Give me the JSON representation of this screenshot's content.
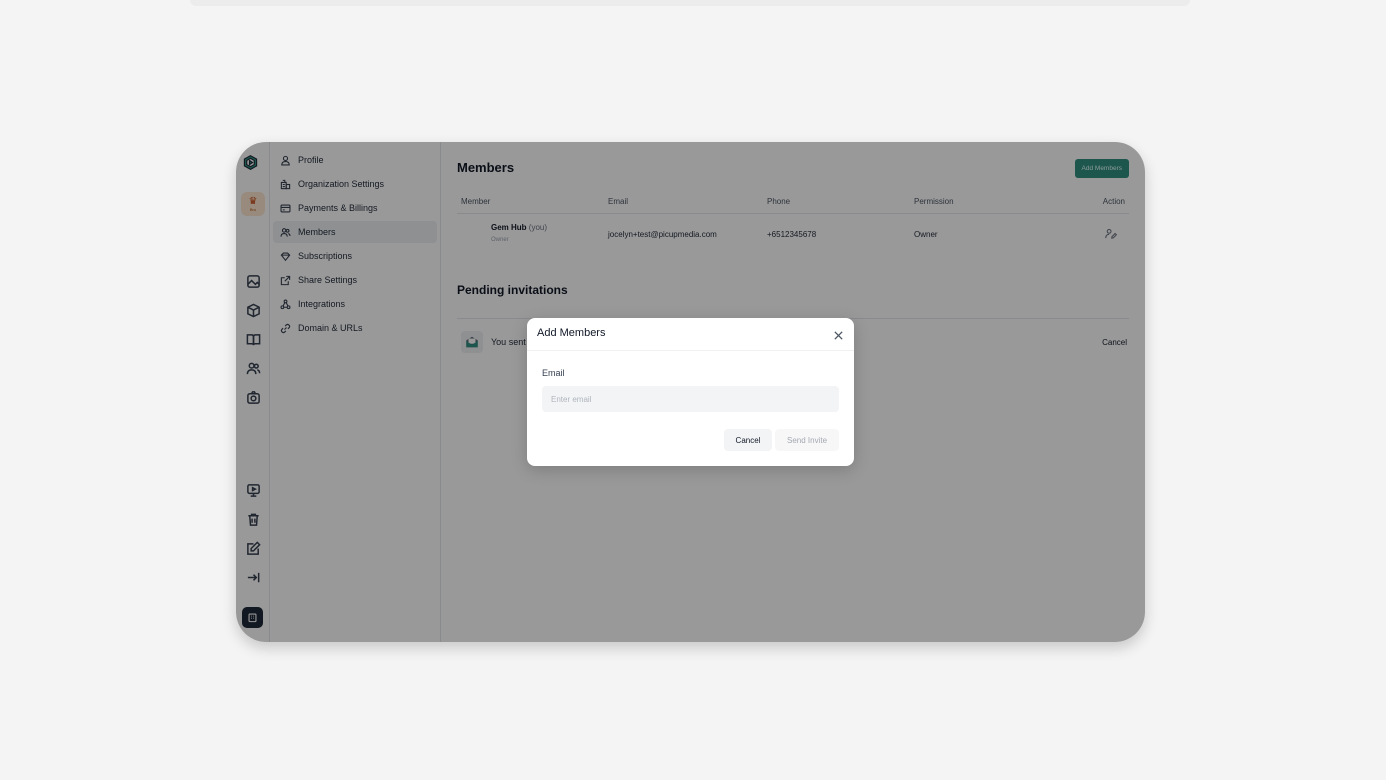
{
  "settings_nav": {
    "items": [
      {
        "label": "Profile",
        "icon": "user-icon",
        "active": false
      },
      {
        "label": "Organization Settings",
        "icon": "building-icon",
        "active": false
      },
      {
        "label": "Payments & Billings",
        "icon": "credit-card-icon",
        "active": false
      },
      {
        "label": "Members",
        "icon": "users-icon",
        "active": true
      },
      {
        "label": "Subscriptions",
        "icon": "diamond-icon",
        "active": false
      },
      {
        "label": "Share Settings",
        "icon": "external-link-icon",
        "active": false
      },
      {
        "label": "Integrations",
        "icon": "integrations-icon",
        "active": false
      },
      {
        "label": "Domain & URLs",
        "icon": "link-icon",
        "active": false
      }
    ]
  },
  "org_badge": {
    "label": "Bro"
  },
  "main": {
    "title": "Members",
    "add_button": "Add Members",
    "columns": [
      "Member",
      "Email",
      "Phone",
      "Permission",
      "Action"
    ],
    "rows": [
      {
        "name": "Gem Hub",
        "you": "(you)",
        "role": "Owner",
        "email": "jocelyn+test@picupmedia.com",
        "phone": "+6512345678",
        "permission": "Owner"
      }
    ],
    "pending_title": "Pending invitations",
    "pending": [
      {
        "text": "You sent",
        "cancel": "Cancel"
      }
    ]
  },
  "modal": {
    "title": "Add Members",
    "email_label": "Email",
    "email_placeholder": "Enter email",
    "email_value": "",
    "cancel_label": "Cancel",
    "send_label": "Send Invite"
  },
  "colors": {
    "accent": "#2f8f80",
    "overlay": "rgba(0,0,0,0.40)"
  }
}
